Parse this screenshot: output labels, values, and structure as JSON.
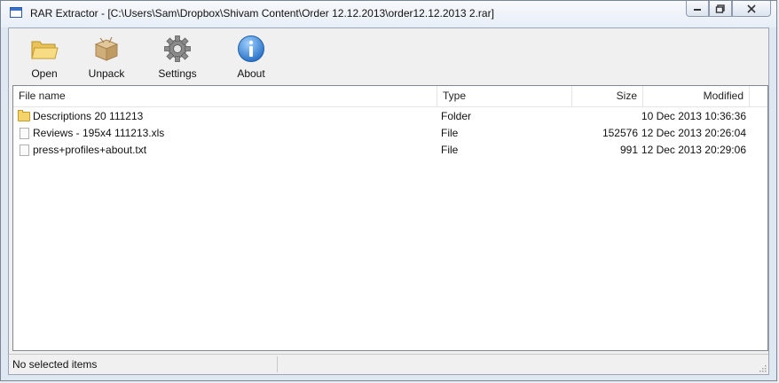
{
  "window": {
    "title": "RAR Extractor - [C:\\Users\\Sam\\Dropbox\\Shivam Content\\Order 12.12.2013\\order12.12.2013 2.rar]"
  },
  "toolbar": {
    "open_label": "Open",
    "unpack_label": "Unpack",
    "settings_label": "Settings",
    "about_label": "About"
  },
  "list": {
    "columns": [
      "File name",
      "Type",
      "Size",
      "Modified"
    ],
    "rows": [
      {
        "name": "Descriptions 20 111213",
        "type": "Folder",
        "size": "",
        "modified": "10 Dec 2013 10:36:36",
        "icon": "folder-icon"
      },
      {
        "name": "Reviews - 195x4 111213.xls",
        "type": "File",
        "size": "152576",
        "modified": "12 Dec 2013 20:26:04",
        "icon": "file-icon"
      },
      {
        "name": "press+profiles+about.txt",
        "type": "File",
        "size": "991",
        "modified": "12 Dec 2013 20:29:06",
        "icon": "file-icon"
      }
    ]
  },
  "status": {
    "text": "No selected items"
  },
  "colors": {
    "about_icon": "#3b86d6",
    "folder": "#f5d36b",
    "settings_icon": "#7d7d7d"
  }
}
